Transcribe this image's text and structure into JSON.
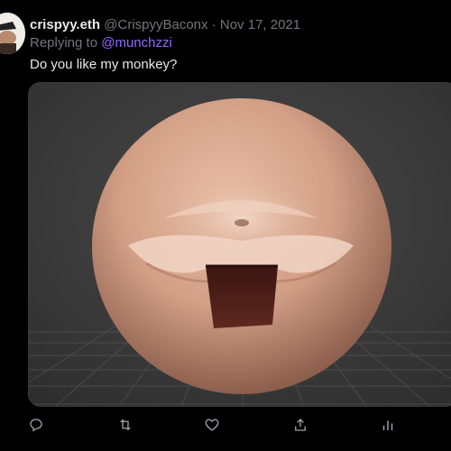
{
  "tweet": {
    "display_name": "crispyy.eth",
    "handle": "@CrispyyBaconx",
    "separator": " · ",
    "date": "Nov 17, 2021",
    "replying_prefix": "Replying to ",
    "replying_to": "@munchzzi",
    "text": "Do you like my monkey?"
  },
  "media": {
    "description_icon": "3d-render-image"
  },
  "actions": [
    {
      "name": "reply-icon"
    },
    {
      "name": "retweet-icon"
    },
    {
      "name": "like-icon"
    },
    {
      "name": "share-icon"
    },
    {
      "name": "analytics-icon"
    }
  ],
  "colors": {
    "background": "#000000",
    "text": "#e7e9ea",
    "muted": "#71767b",
    "mention": "#8f6bff"
  }
}
